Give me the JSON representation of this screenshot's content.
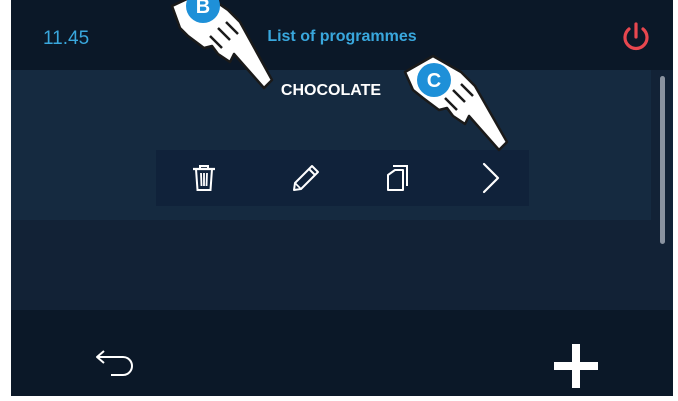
{
  "header": {
    "time": "11.45",
    "title": "List of programmes"
  },
  "programme": {
    "name": "CHOCOLATE"
  },
  "actions": [
    {
      "icon": "trash-icon"
    },
    {
      "icon": "pencil-icon"
    },
    {
      "icon": "copy-icon"
    },
    {
      "icon": "chevron-right-icon"
    }
  ],
  "callouts": [
    {
      "letter": "B"
    },
    {
      "letter": "C"
    }
  ],
  "colors": {
    "background": "#0b1828",
    "accent": "#39a7dd",
    "power": "#e8474f",
    "badge": "#1e90d8"
  }
}
